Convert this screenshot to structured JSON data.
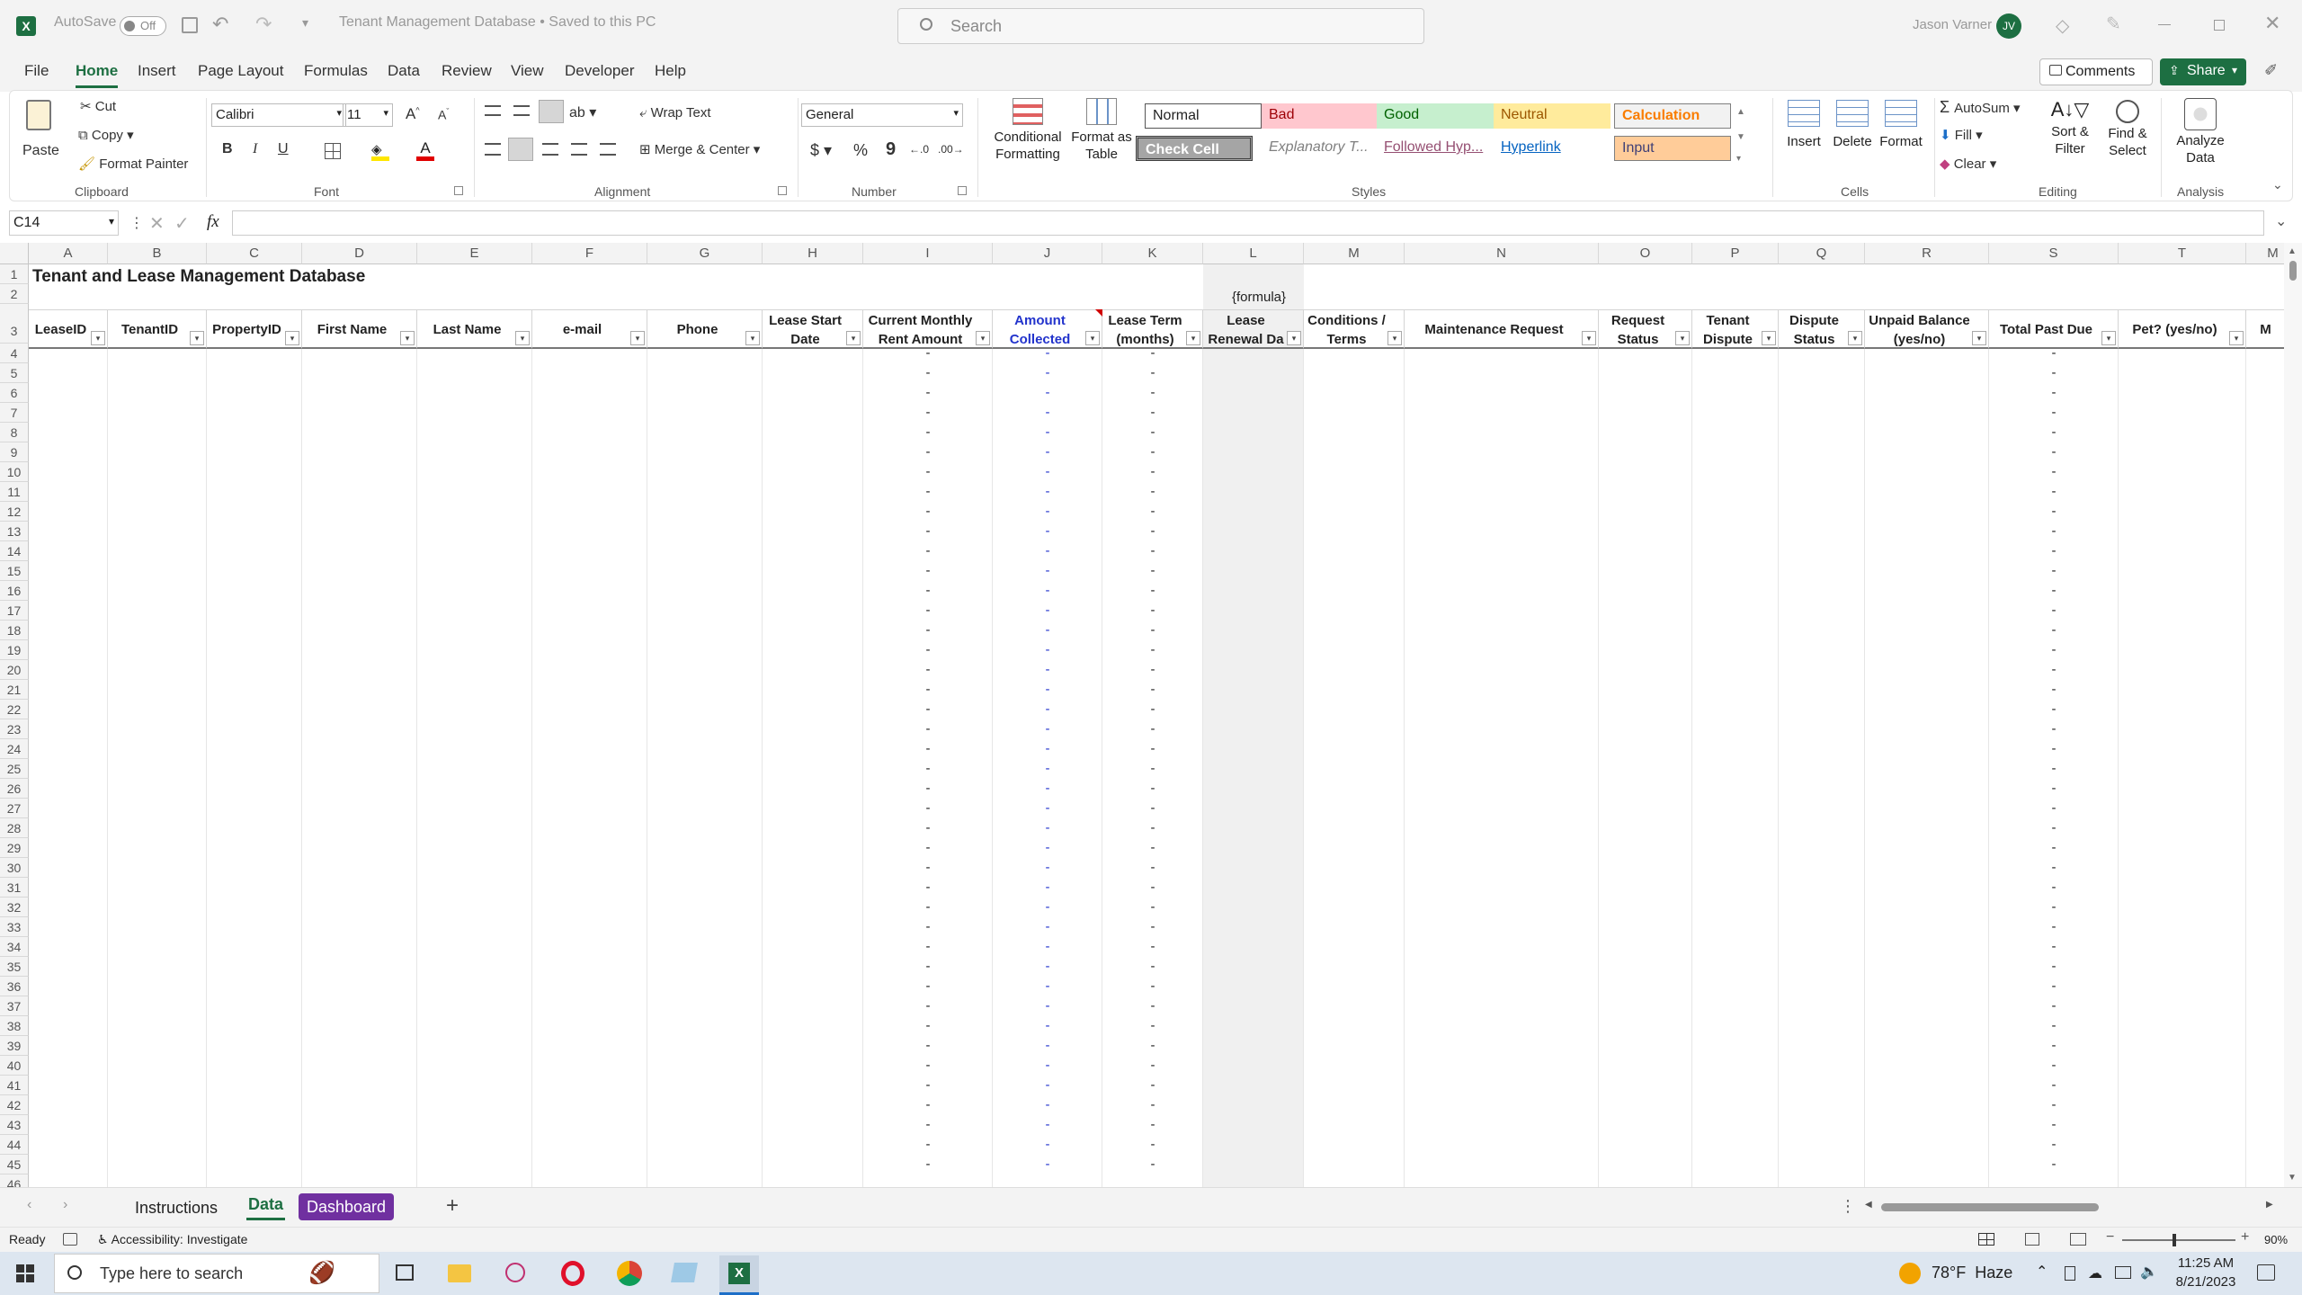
{
  "titlebar": {
    "autosave_label": "AutoSave",
    "autosave_state": "Off",
    "doc_title": "Tenant Management Database • Saved to this PC",
    "search_placeholder": "Search",
    "user_name": "Jason Varner",
    "user_initials": "JV"
  },
  "menu": [
    "File",
    "Home",
    "Insert",
    "Page Layout",
    "Formulas",
    "Data",
    "Review",
    "View",
    "Developer",
    "Help"
  ],
  "menu_active": "Home",
  "comments_label": "Comments",
  "share_label": "Share",
  "ribbon": {
    "clipboard": {
      "paste": "Paste",
      "cut": "Cut",
      "copy": "Copy",
      "format_painter": "Format Painter",
      "label": "Clipboard"
    },
    "font": {
      "name": "Calibri",
      "size": "11",
      "bold": "B",
      "italic": "I",
      "underline": "U",
      "label": "Font"
    },
    "alignment": {
      "wrap": "Wrap Text",
      "merge": "Merge & Center",
      "label": "Alignment"
    },
    "number": {
      "format": "General",
      "label": "Number"
    },
    "styles": {
      "conditional": "Conditional Formatting",
      "format_table": "Format as Table",
      "cells": [
        {
          "label": "Normal",
          "bg": "#ffffff",
          "fg": "#222222"
        },
        {
          "label": "Bad",
          "bg": "#ffc7ce",
          "fg": "#9c0006"
        },
        {
          "label": "Good",
          "bg": "#c6efce",
          "fg": "#006100"
        },
        {
          "label": "Neutral",
          "bg": "#ffeb9c",
          "fg": "#9c5700"
        },
        {
          "label": "Calculation",
          "bg": "#f2f2f2",
          "fg": "#fa7d00"
        },
        {
          "label": "Check Cell",
          "bg": "#a5a5a5",
          "fg": "#ffffff"
        },
        {
          "label": "Explanatory T...",
          "bg": "#ffffff",
          "fg": "#7f7f7f"
        },
        {
          "label": "Followed Hyp...",
          "bg": "#ffffff",
          "fg": "#954f72"
        },
        {
          "label": "Hyperlink",
          "bg": "#ffffff",
          "fg": "#0563c1"
        },
        {
          "label": "Input",
          "bg": "#ffcc99",
          "fg": "#3f3f76"
        }
      ],
      "label": "Styles"
    },
    "cells": {
      "insert": "Insert",
      "delete": "Delete",
      "format": "Format",
      "label": "Cells"
    },
    "editing": {
      "autosum": "AutoSum",
      "fill": "Fill",
      "clear": "Clear",
      "sort": "Sort & Filter",
      "find": "Find & Select",
      "label": "Editing"
    },
    "analysis": {
      "analyze": "Analyze Data",
      "label": "Analysis"
    }
  },
  "formula_bar": {
    "name_box": "C14",
    "fx": "fx",
    "content": ""
  },
  "sheet": {
    "col_letters": [
      "A",
      "B",
      "C",
      "D",
      "E",
      "F",
      "G",
      "H",
      "I",
      "J",
      "K",
      "L",
      "M",
      "N",
      "O",
      "P",
      "Q",
      "R",
      "S",
      "T",
      "M"
    ],
    "title": "Tenant and Lease Management Database",
    "formula_note": "{formula}",
    "headers": [
      "LeaseID",
      "TenantID",
      "PropertyID",
      "First Name",
      "Last Name",
      "e-mail",
      "Phone",
      "Lease Start Date",
      "Current Monthly Rent Amount",
      "Amount Collected",
      "Lease Term (months)",
      "Lease Renewal Da",
      "Conditions / Terms",
      "Maintenance Request",
      "Request Status",
      "Tenant Dispute",
      "Dispute Status",
      "Unpaid Balance (yes/no)",
      "Total Past Due",
      "Pet? (yes/no)",
      "M"
    ],
    "row_numbers": [
      "1",
      "2",
      "3",
      "4",
      "5",
      "6",
      "7",
      "8",
      "9",
      "10",
      "11",
      "12",
      "13",
      "14",
      "15",
      "16",
      "17",
      "18",
      "19",
      "20",
      "21",
      "22",
      "23",
      "24",
      "25",
      "26",
      "27",
      "28",
      "29",
      "30",
      "31",
      "32",
      "33",
      "34",
      "35",
      "36",
      "37",
      "38",
      "39",
      "40",
      "41",
      "42",
      "43",
      "44",
      "45",
      "46"
    ],
    "dash": "-",
    "amount_collected_color": "#2233cc",
    "renewal_shade": "#f0f0f0"
  },
  "tabs": [
    "Instructions",
    "Data",
    "Dashboard"
  ],
  "tab_active": "Data",
  "dashboard_tab_color": "#7030a0",
  "status": {
    "ready": "Ready",
    "accessibility": "Accessibility: Investigate",
    "zoom": "90%"
  },
  "taskbar": {
    "search_placeholder": "Type here to search",
    "weather": "78°F  Haze",
    "time": "11:25 AM",
    "date": "8/21/2023"
  }
}
